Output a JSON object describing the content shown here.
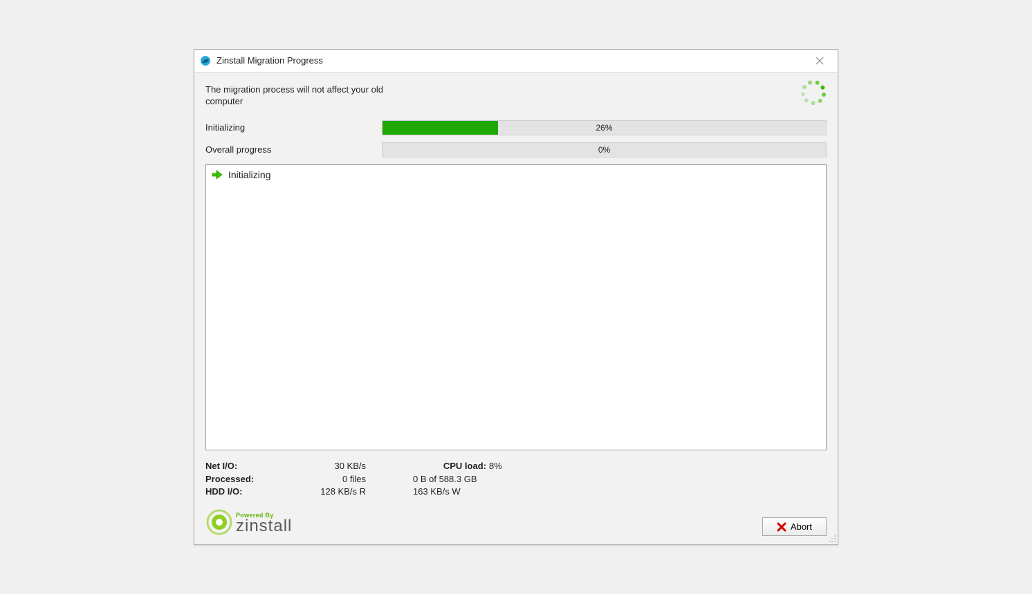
{
  "window": {
    "title": "Zinstall Migration Progress"
  },
  "info_text": "The migration process will not affect your old computer",
  "progress": {
    "initializing": {
      "label": "Initializing",
      "percent": 26,
      "text": "26%"
    },
    "overall": {
      "label": "Overall progress",
      "percent": 0,
      "text": "0%"
    }
  },
  "log": {
    "items": [
      "Initializing"
    ]
  },
  "stats": {
    "net_io": {
      "label": "Net I/O:",
      "value": "30 KB/s"
    },
    "processed": {
      "label": "Processed:",
      "value": "0 files"
    },
    "hdd_io": {
      "label": "HDD I/O:",
      "read": "128 KB/s R",
      "write": "163 KB/s W"
    },
    "cpu_load": {
      "label": "CPU load:",
      "value": "8%"
    },
    "data_total": {
      "value": "0 B of 588.3 GB"
    }
  },
  "branding": {
    "powered_by": "Powered By",
    "name": "zinstall"
  },
  "buttons": {
    "abort": "Abort"
  }
}
